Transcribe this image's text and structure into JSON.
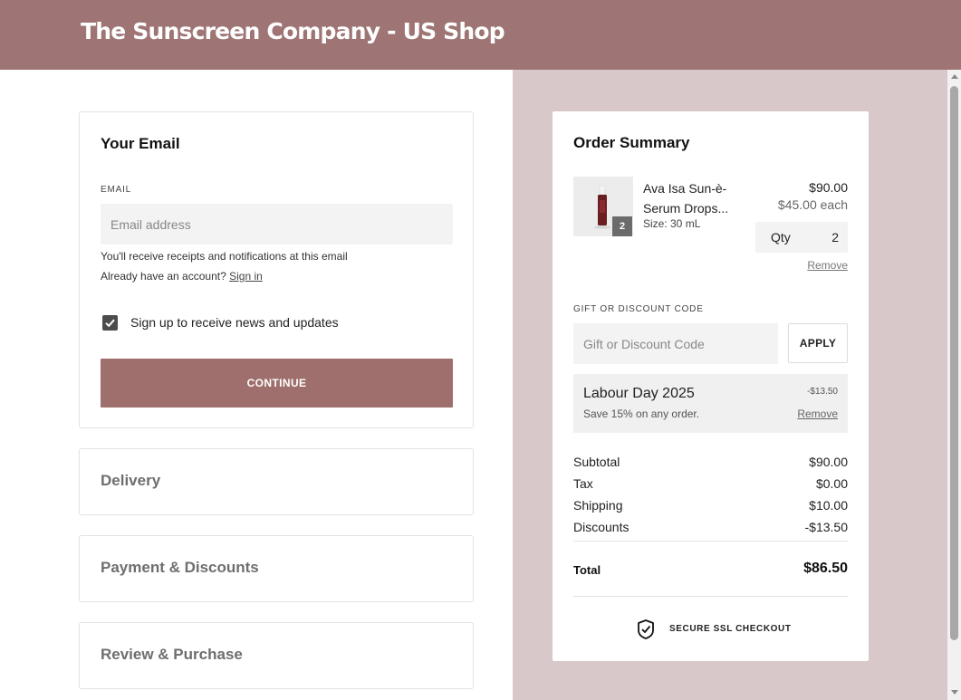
{
  "header": {
    "title": "The Sunscreen Company - US Shop"
  },
  "email_section": {
    "title": "Your Email",
    "field_label": "EMAIL",
    "placeholder": "Email address",
    "value": "",
    "helper_receipts": "You'll receive receipts and notifications at this email",
    "helper_account_prefix": "Already have an account?",
    "sign_in_link": "Sign in",
    "newsletter_checked": true,
    "newsletter_label": "Sign up to receive news and updates",
    "continue_label": "CONTINUE"
  },
  "steps": [
    {
      "label": "Delivery"
    },
    {
      "label": "Payment & Discounts"
    },
    {
      "label": "Review & Purchase"
    }
  ],
  "order_summary": {
    "title": "Order Summary",
    "product": {
      "name": "Ava Isa Sun-è-Serum Drops...",
      "size": "Size: 30 mL",
      "price": "$90.00",
      "each": "$45.00 each",
      "qty_label": "Qty",
      "qty": "2",
      "badge": "2",
      "remove_label": "Remove"
    },
    "gift": {
      "label": "GIFT OR DISCOUNT CODE",
      "placeholder": "Gift or Discount Code",
      "apply_label": "APPLY"
    },
    "discount": {
      "name": "Labour Day 2025",
      "description": "Save 15% on any order.",
      "amount": "-$13.50",
      "remove_label": "Remove"
    },
    "lines": {
      "subtotal_label": "Subtotal",
      "subtotal": "$90.00",
      "tax_label": "Tax",
      "tax": "$0.00",
      "shipping_label": "Shipping",
      "shipping": "$10.00",
      "discounts_label": "Discounts",
      "discounts": "-$13.50"
    },
    "total_label": "Total",
    "total": "$86.50",
    "secure_label": "SECURE SSL CHECKOUT",
    "secure_icon": "shield-check-icon"
  },
  "colors": {
    "header_bg": "#9e7574",
    "right_panel_bg": "#d9c8ca",
    "continue_bg": "#9e6f6c"
  }
}
